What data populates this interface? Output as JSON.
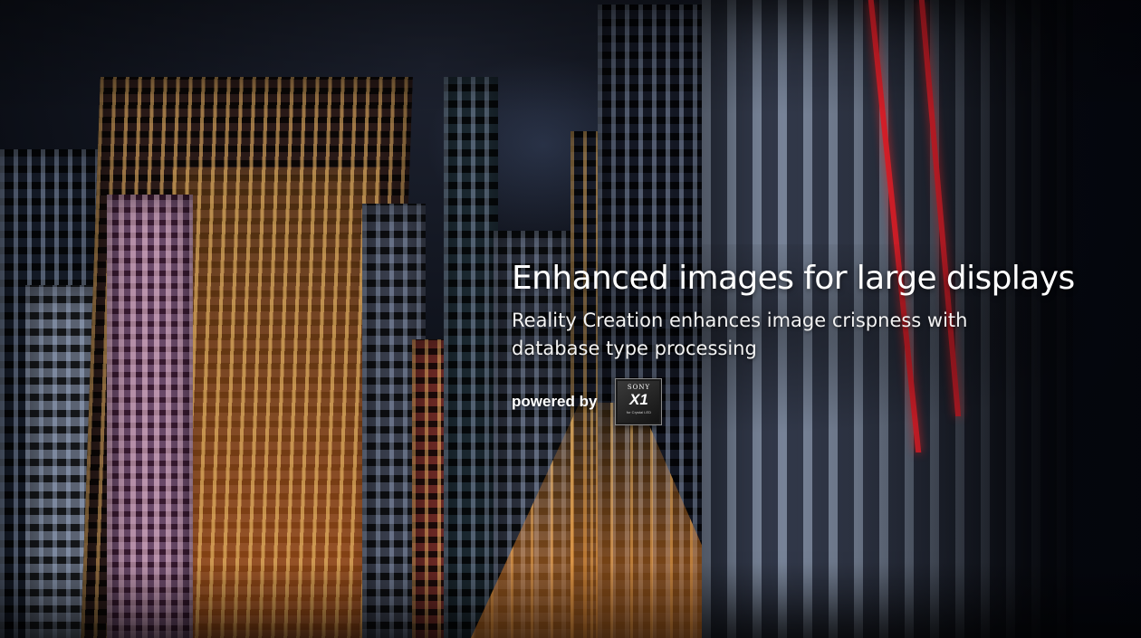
{
  "hero": {
    "headline": "Enhanced images for large displays",
    "description": "Reality Creation enhances image crispness with database type processing",
    "powered_by_label": "powered by",
    "badge": {
      "brand": "SONY",
      "model": "X1",
      "subtitle": "for Crystal LED"
    }
  },
  "background": {
    "scene": "night city skyline photograph",
    "accent_colors": {
      "window_light": "#ffb45a",
      "red_stripe": "#e4202a",
      "sky": "#0b0e16"
    }
  }
}
